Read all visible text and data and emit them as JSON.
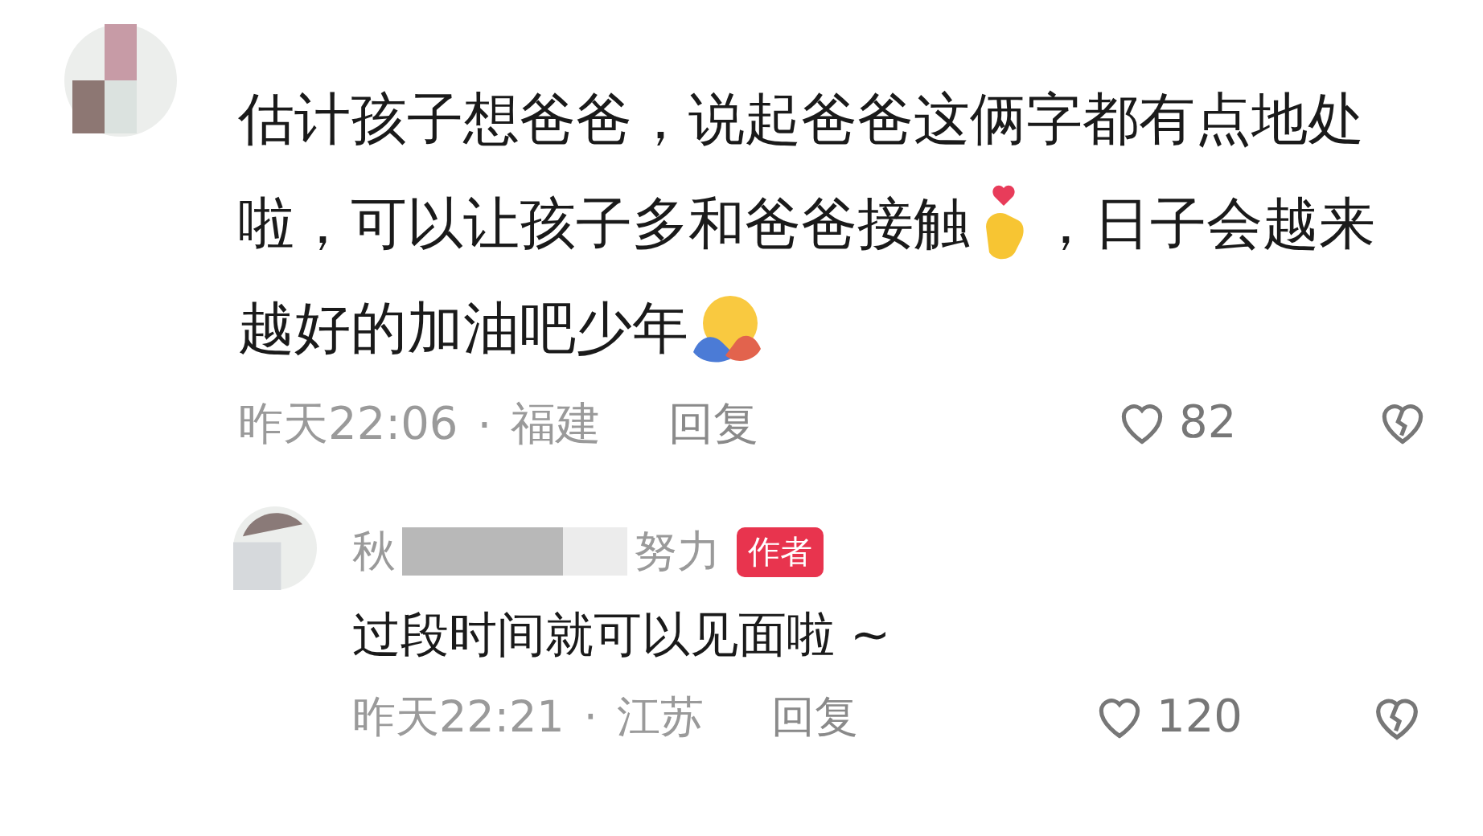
{
  "comment": {
    "lines": [
      [
        {
          "kind": "text",
          "text": "估计孩子想爸爸，说起爸爸这俩字都有点地处"
        }
      ],
      [
        {
          "kind": "text",
          "text": "啦，可以让孩子多和爸爸接触"
        },
        {
          "kind": "finger-heart"
        },
        {
          "kind": "text",
          "text": "，日子会越来"
        }
      ],
      [
        {
          "kind": "text",
          "text": "越好的加油吧少年"
        },
        {
          "kind": "hug"
        }
      ]
    ],
    "time": "昨天22:06",
    "separator": "·",
    "location": "福建",
    "reply_label": "回复",
    "likes": "82"
  },
  "reply": {
    "name_start": "秋",
    "name_end": "努力",
    "badge": "作者",
    "text": "过段时间就可以见面啦 ~",
    "time": "昨天22:21",
    "separator": "·",
    "location": "江苏",
    "reply_label": "回复",
    "likes": "120"
  }
}
